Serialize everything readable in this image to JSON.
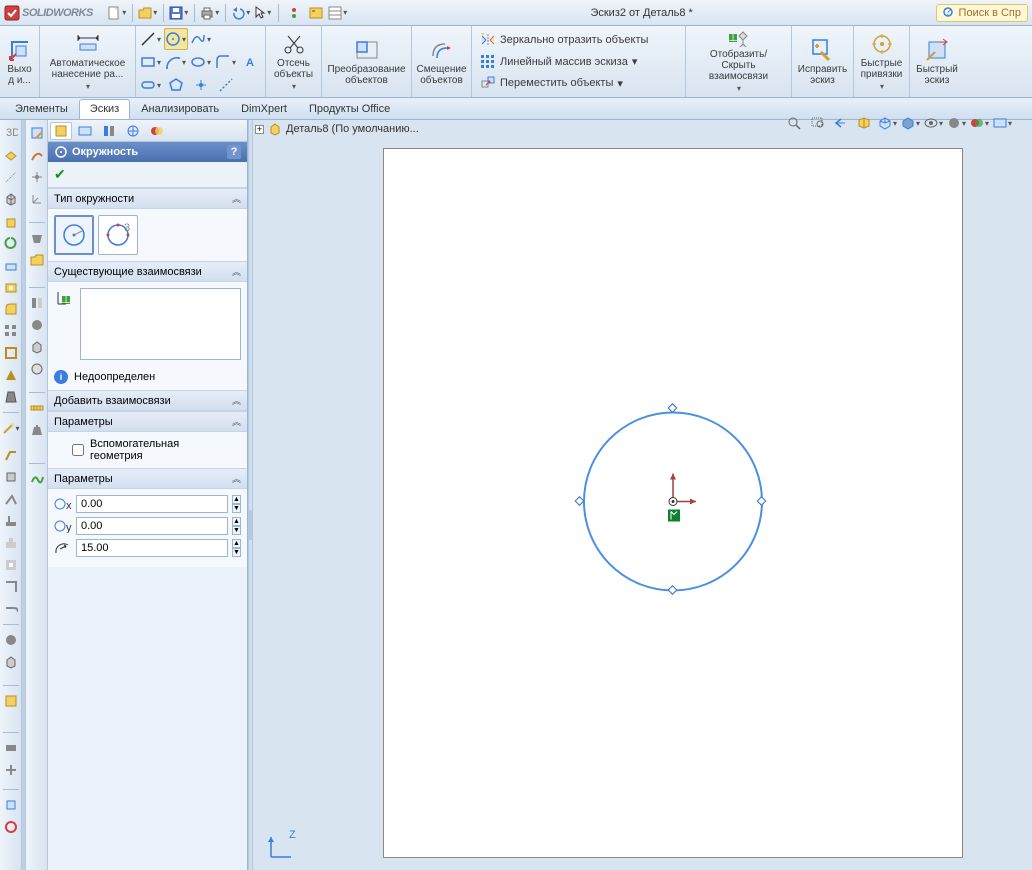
{
  "app": {
    "brand": "SOLIDWORKS",
    "title": "Эскиз2 от Деталь8 *",
    "search_placeholder": "Поиск в Спр"
  },
  "ribbon": {
    "exit": "Выхо\nд и...",
    "autodim": "Автоматическое\nнанесение ра...",
    "trim": "Отсечь\nобъекты",
    "convert": "Преобразование\nобъектов",
    "offset": "Смещение\nобъектов",
    "mirror": "Зеркально отразить объекты",
    "linear": "Линейный массив эскиза",
    "move": "Переместить объекты",
    "showhide": "Отобразить/Скрыть\nвзаимосвязи",
    "repair": "Исправить\nэскиз",
    "snaps": "Быстрые\nпривязки",
    "quick": "Быстрый\nэскиз"
  },
  "tabs": [
    "Элементы",
    "Эскиз",
    "Анализировать",
    "DimXpert",
    "Продукты Office"
  ],
  "pm": {
    "title": "Окружность",
    "sec_type": "Тип окружности",
    "sec_rel": "Существующие взаимосвязи",
    "rel_status": "Недоопределен",
    "sec_addrel": "Добавить взаимосвязи",
    "sec_opt": "Параметры",
    "aux_geom": "Вспомогательная\nгеометрия",
    "sec_params": "Параметры",
    "cx": "0.00",
    "cy": "0.00",
    "r": "15.00"
  },
  "canvas": {
    "crumb": "Деталь8  (По умолчанию...",
    "triad_z": "Z"
  }
}
